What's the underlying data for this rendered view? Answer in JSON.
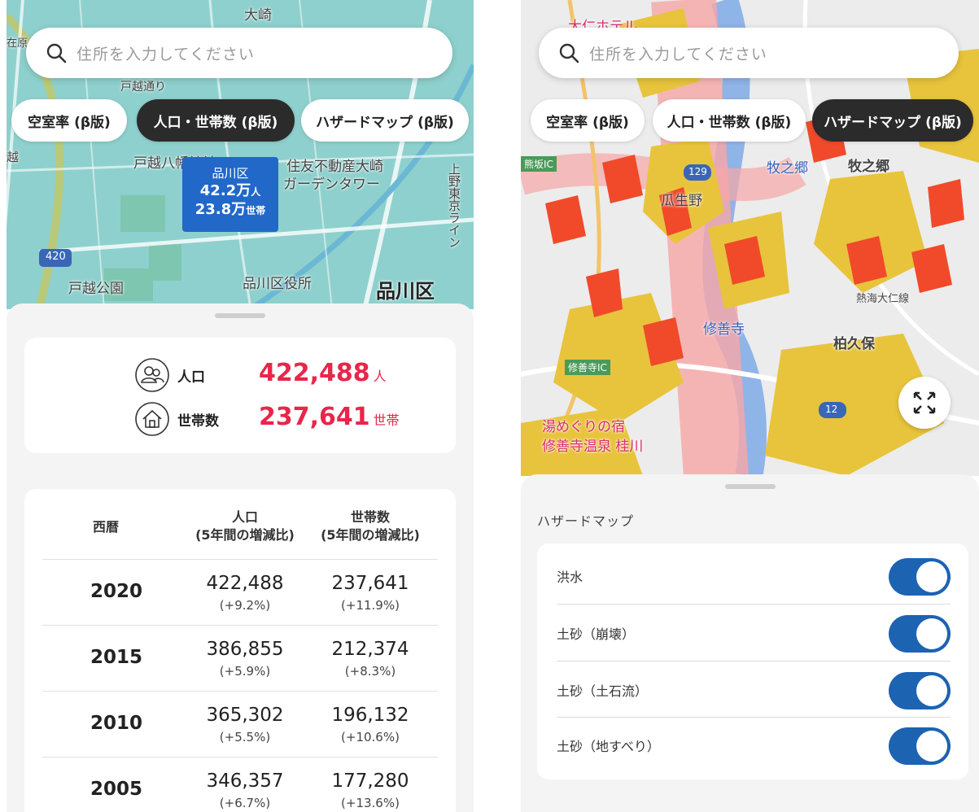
{
  "left": {
    "search_placeholder": "住所を入力してください",
    "chips": [
      "空室率 (β版)",
      "人口・世帯数 (β版)",
      "ハザードマップ (β版)"
    ],
    "active_chip": "人口・世帯数 (β版)",
    "map_labels": {
      "station": "大崎",
      "place1": "戸越八幡神社",
      "place2": "住友不動産大崎",
      "place3": "ガーデンタワー",
      "park": "戸越公園",
      "office": "品川区役所",
      "ward": "品川区",
      "route": "420",
      "road": "上野東京ライン",
      "edge1": "在原",
      "edge2": "越",
      "street": "戸越通り"
    },
    "callout": {
      "name": "品川区",
      "population": "42.2万",
      "population_unit": "人",
      "households": "23.8万",
      "households_unit": "世帯"
    },
    "summary": {
      "population_label": "人口",
      "population_value": "422,488",
      "population_unit": "人",
      "households_label": "世帯数",
      "households_value": "237,641",
      "households_unit": "世帯"
    },
    "table": {
      "headers": {
        "year": "西暦",
        "pop": "人口",
        "pop_sub": "(5年間の増減比)",
        "hh": "世帯数",
        "hh_sub": "(5年間の増減比)"
      },
      "rows": [
        {
          "year": "2020",
          "pop": "422,488",
          "pop_change": "(+9.2%)",
          "hh": "237,641",
          "hh_change": "(+11.9%)"
        },
        {
          "year": "2015",
          "pop": "386,855",
          "pop_change": "(+5.9%)",
          "hh": "212,374",
          "hh_change": "(+8.3%)"
        },
        {
          "year": "2010",
          "pop": "365,302",
          "pop_change": "(+5.5%)",
          "hh": "196,132",
          "hh_change": "(+10.6%)"
        },
        {
          "year": "2005",
          "pop": "346,357",
          "pop_change": "(+6.7%)",
          "hh": "177,280",
          "hh_change": "(+13.6%)"
        }
      ]
    }
  },
  "right": {
    "search_placeholder": "住所を入力してください",
    "chips": [
      "空室率 (β版)",
      "人口・世帯数 (β版)",
      "ハザードマップ (β版)"
    ],
    "active_chip": "ハザードマップ (β版)",
    "map_labels": {
      "ic1": "熊坂IC",
      "route1": "129",
      "station1": "牧之郷",
      "area1": "牧之郷",
      "area2": "瓜生野",
      "line": "熱海大仁線",
      "station2": "修善寺",
      "area3": "柏久保",
      "ic2": "修善寺IC",
      "route2": "12",
      "hotel1": "湯めぐりの宿",
      "hotel2": "修善寺温泉 桂川",
      "hotel_top": "大仁ホテル"
    },
    "section_title": "ハザードマップ",
    "layers": [
      {
        "label": "洪水",
        "on": true
      },
      {
        "label": "土砂（崩壊）",
        "on": true
      },
      {
        "label": "土砂（土石流）",
        "on": true
      },
      {
        "label": "土砂（地すべり）",
        "on": true
      }
    ],
    "colors": {
      "toggle_on": "#1c63b2",
      "hazard_red": "#f04a2a",
      "hazard_yellow": "#e8c43c",
      "hazard_pink": "#f7a6a6"
    }
  }
}
